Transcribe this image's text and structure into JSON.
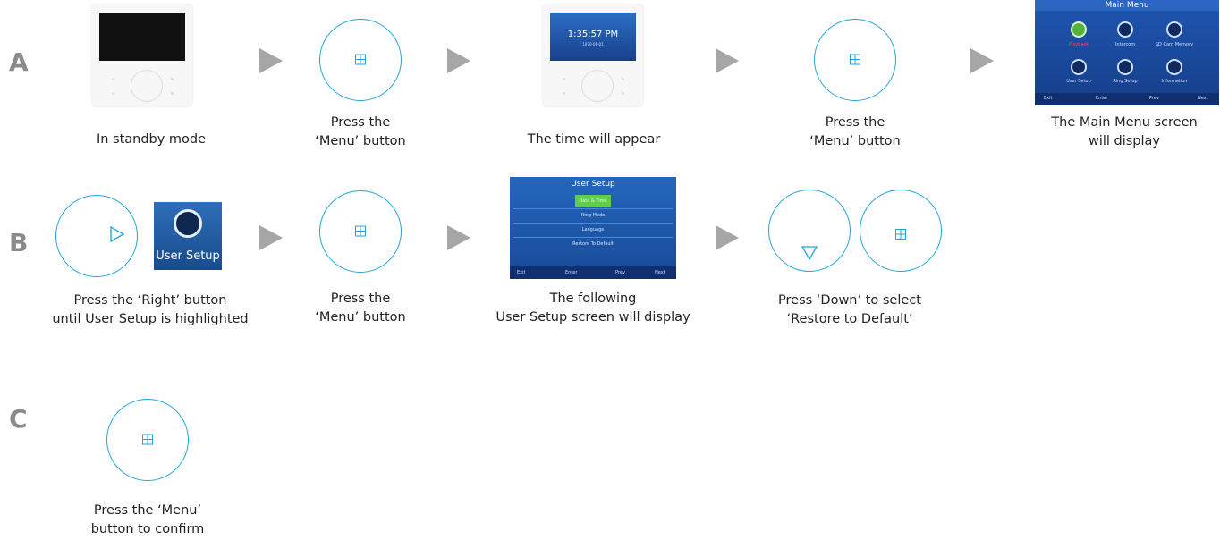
{
  "rows": {
    "a": "A",
    "b": "B",
    "c": "C"
  },
  "captions": {
    "a1": [
      "In standby mode"
    ],
    "a2": [
      "Press the",
      "‘Menu’ button"
    ],
    "a3": [
      "The time will appear"
    ],
    "a4": [
      "Press the",
      "‘Menu’ button"
    ],
    "a5": [
      "The Main Menu screen",
      "will display"
    ],
    "b1": [
      "Press the ‘Right’ button",
      "until User Setup is highlighted"
    ],
    "b2": [
      "Press the",
      "‘Menu’ button"
    ],
    "b3": [
      "The following",
      "User Setup screen will display"
    ],
    "b4": [
      "Press ‘Down’  to select",
      "‘Restore to Default’"
    ],
    "c1": [
      "Press the ‘Menu’",
      "button to confirm"
    ]
  },
  "device": {
    "time": "1:35:57 PM",
    "date": "1970-01-01"
  },
  "main_menu": {
    "title": "Main Menu",
    "items": [
      "Playback",
      "Intercom",
      "SD Card Memory",
      "User Setup",
      "Ring Setup",
      "Information"
    ],
    "bar": [
      "Exit",
      "Enter",
      "Prev",
      "Next"
    ]
  },
  "user_setup_tile": {
    "label": "User Setup"
  },
  "user_setup": {
    "title": "User Setup",
    "rows": [
      "Date & Time",
      "Ring Mode",
      "Language",
      "Restore To Default"
    ],
    "bar": [
      "Exit",
      "Enter",
      "Prev",
      "Next"
    ]
  },
  "colors": {
    "accent": "#1fa3dc",
    "arrow": "#a6a6a6",
    "label": "#8a8a8a"
  },
  "icons": {
    "menu": "grid-icon",
    "right": "triangle-right-icon",
    "down": "triangle-down-icon"
  }
}
